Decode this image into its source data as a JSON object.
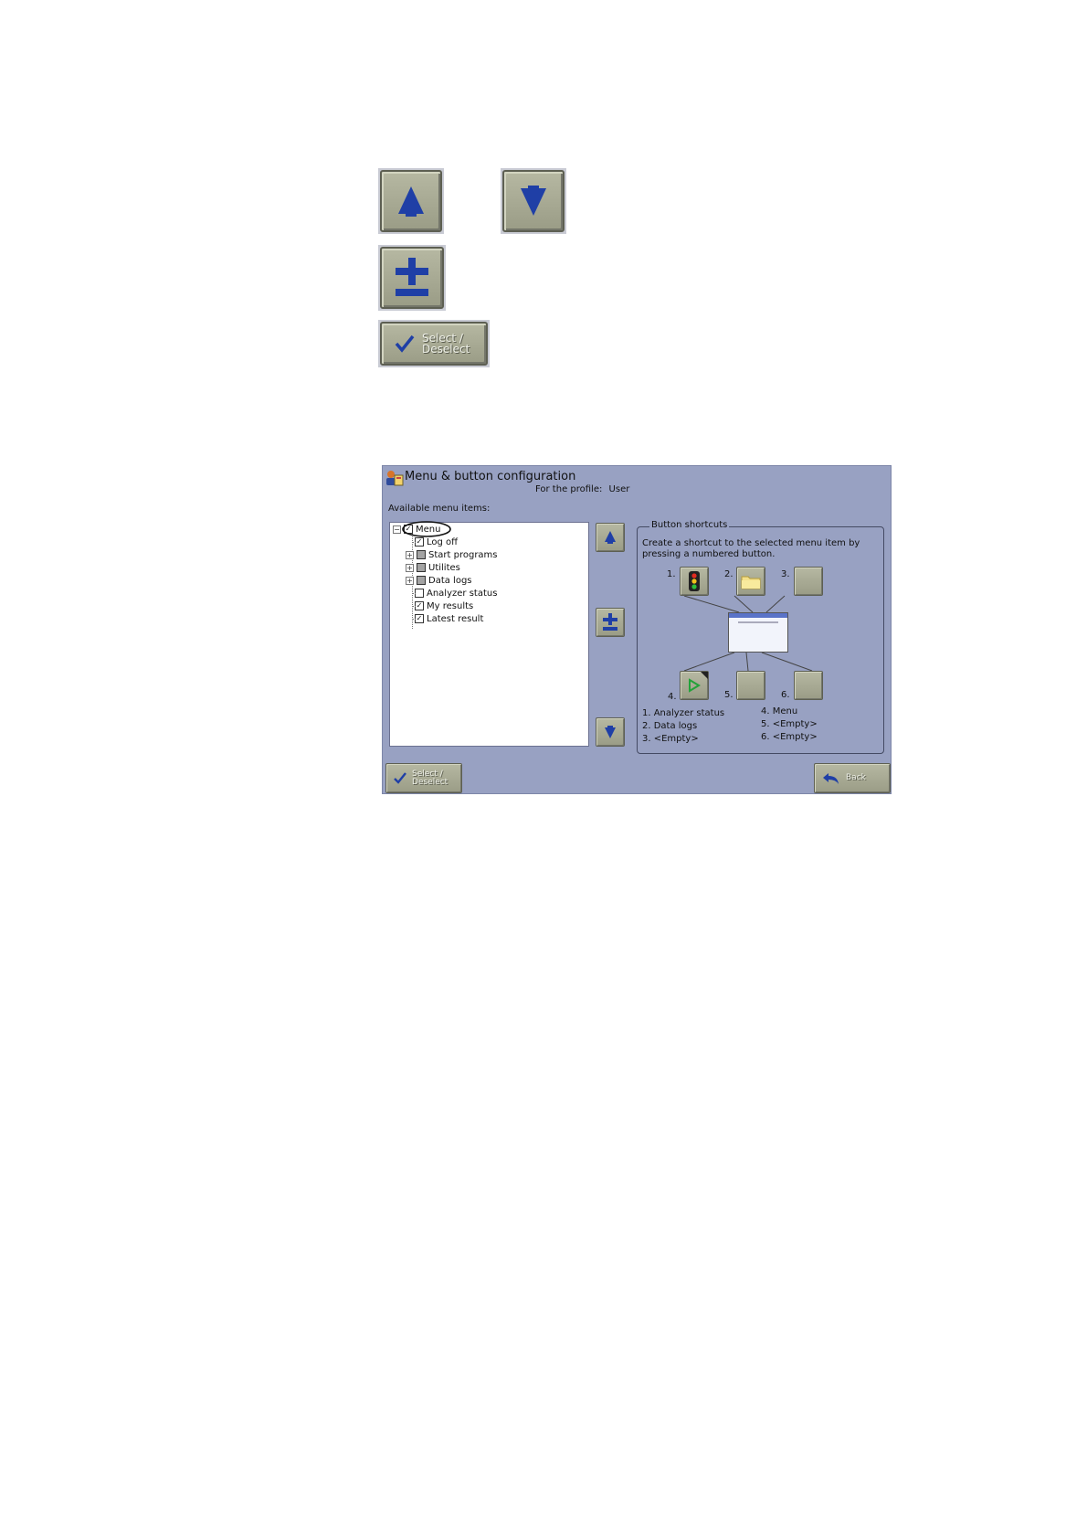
{
  "standalone": {
    "select_label_1": "Select /",
    "select_label_2": "Deselect"
  },
  "window": {
    "title": "Menu & button configuration",
    "profile_label": "For the profile:",
    "profile_value": "User",
    "available_label": "Available menu items:"
  },
  "tree": {
    "root": "Menu",
    "items": [
      {
        "label": "Log off",
        "state": "checked",
        "expandable": false
      },
      {
        "label": "Start programs",
        "state": "partial",
        "expandable": true
      },
      {
        "label": "Utilites",
        "state": "partial",
        "expandable": true
      },
      {
        "label": "Data logs",
        "state": "partial",
        "expandable": true
      },
      {
        "label": "Analyzer status",
        "state": "unchecked",
        "expandable": false
      },
      {
        "label": "My results",
        "state": "checked",
        "expandable": false
      },
      {
        "label": "Latest result",
        "state": "checked",
        "expandable": false
      }
    ]
  },
  "shortcuts": {
    "legend": "Button shortcuts",
    "description": "Create a shortcut to the selected menu item by pressing a numbered button.",
    "numbers": [
      "1.",
      "2.",
      "3.",
      "4.",
      "5.",
      "6."
    ],
    "assigned_left": [
      "1. Analyzer status",
      "2. Data logs",
      "3. <Empty>"
    ],
    "assigned_right": [
      "4. Menu",
      "5. <Empty>",
      "6. <Empty>"
    ]
  },
  "bottom": {
    "select_label_1": "Select /",
    "select_label_2": "Deselect",
    "back_label": "Back"
  },
  "colors": {
    "panel_bg": "#98a1c2",
    "button_face": "#a8aa94",
    "arrow_blue": "#1f3fa6"
  }
}
